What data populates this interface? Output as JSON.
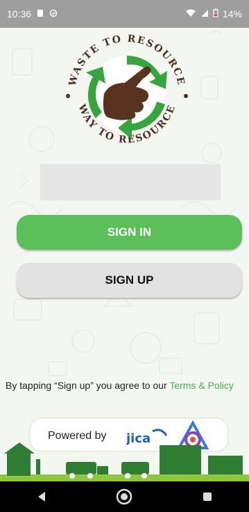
{
  "status_bar": {
    "time": "10:36",
    "battery": "14%"
  },
  "logo": {
    "top_text": "WASTE TO RESOURCE",
    "bottom_text": "WAY TO RESOURCE"
  },
  "form": {
    "field_placeholder": ""
  },
  "buttons": {
    "sign_in": "SIGN IN",
    "sign_up": "SIGN UP"
  },
  "terms": {
    "prefix": "By tapping “Sign up” you agree to our ",
    "link": "Terms & Policy"
  },
  "footer": {
    "powered_by": "Powered by",
    "jica": "JICA"
  },
  "colors": {
    "primary_green": "#5cc05a",
    "link_green": "#4cae4c"
  },
  "icons": {
    "status_left": [
      "notification-icon",
      "sync-icon"
    ],
    "status_right": [
      "wifi-icon",
      "signal-icon",
      "battery-icon"
    ],
    "nav": [
      "back-icon",
      "home-icon",
      "recents-icon"
    ]
  }
}
